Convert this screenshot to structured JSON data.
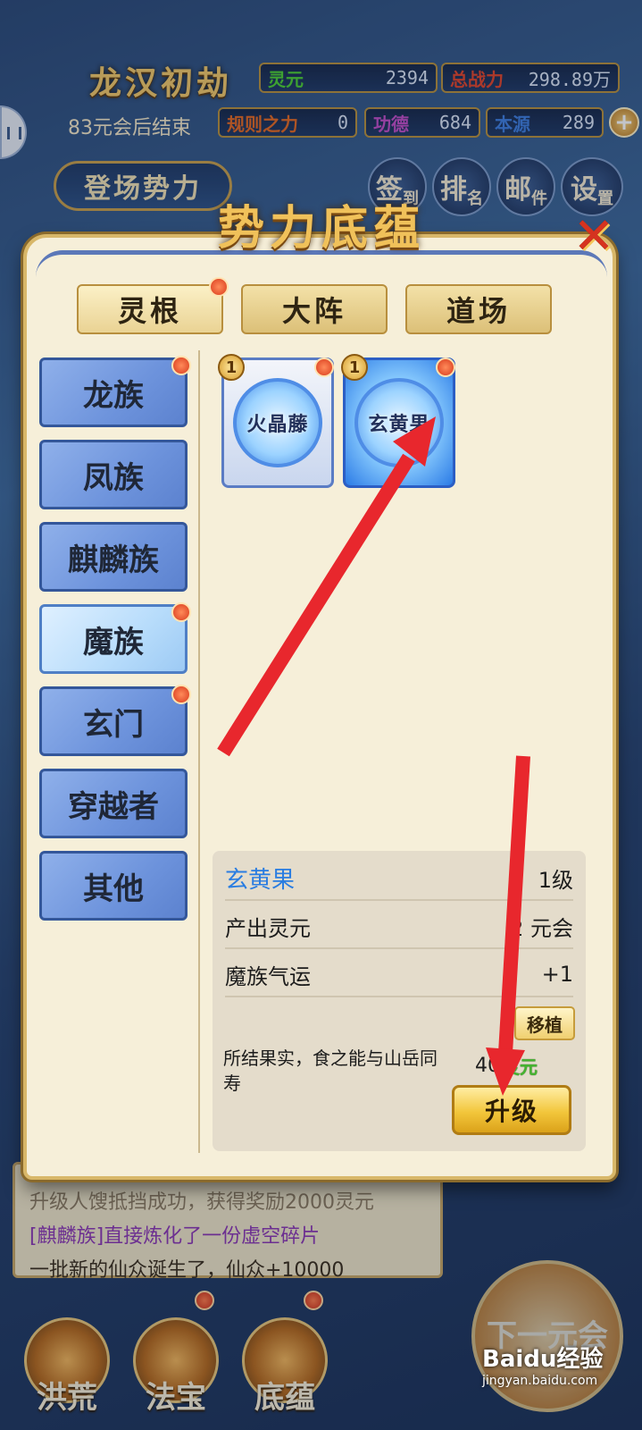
{
  "hud": {
    "title": "龙汉初劫",
    "countdown": "83元会后结束",
    "stats": {
      "lingyuan_label": "灵元",
      "lingyuan_value": "2394",
      "power_label": "总战力",
      "power_value": "298.89万",
      "rule_label": "规则之力",
      "rule_value": "0",
      "merit_label": "功德",
      "merit_value": "684",
      "origin_label": "本源",
      "origin_value": "289"
    },
    "faction_button": "登场势力",
    "menu": [
      {
        "main": "签",
        "sub": "到"
      },
      {
        "main": "排",
        "sub": "名"
      },
      {
        "main": "邮",
        "sub": "件"
      },
      {
        "main": "设",
        "sub": "置"
      }
    ]
  },
  "modal": {
    "title": "势力底蕴",
    "close_icon": "x-icon",
    "tabs": [
      "灵根",
      "大阵",
      "道场"
    ],
    "categories": [
      "龙族",
      "凤族",
      "麒麟族",
      "魔族",
      "玄门",
      "穿越者",
      "其他"
    ],
    "cards": [
      {
        "name": "火晶藤",
        "level": "1"
      },
      {
        "name": "玄黄果",
        "level": "1"
      }
    ],
    "detail": {
      "name": "玄黄果",
      "level": "1级",
      "row1_label": "产出灵元",
      "row1_value": "2 元会",
      "row2_label": "魔族气运",
      "row2_value": "+1",
      "move_label": "移植",
      "description": "所结果实，食之能与山岳同寿",
      "cost_value": "40",
      "cost_unit": "灵元",
      "upgrade_label": "升级"
    }
  },
  "log": {
    "line1": "升级人馊抵挡成功，获得奖励2000灵元",
    "line2": "[麒麟族]直接炼化了一份虚空碎片",
    "line3": "一批新的仙众诞生了，仙众+10000"
  },
  "bottom_nav": [
    "洪荒",
    "法宝",
    "底蕴"
  ],
  "next_button": "下一元会",
  "watermark": {
    "brand": "Baidu经验",
    "url": "jingyan.baidu.com"
  },
  "colors": {
    "accent_gold": "#f0c15a",
    "tab_bg": "#ecd9a0",
    "category_blue": "#6d93dc",
    "selected_category": "#b7dcfb",
    "name_blue": "#2a7de1",
    "resource_green": "#44b52e",
    "annotation_red": "#e8272d"
  }
}
